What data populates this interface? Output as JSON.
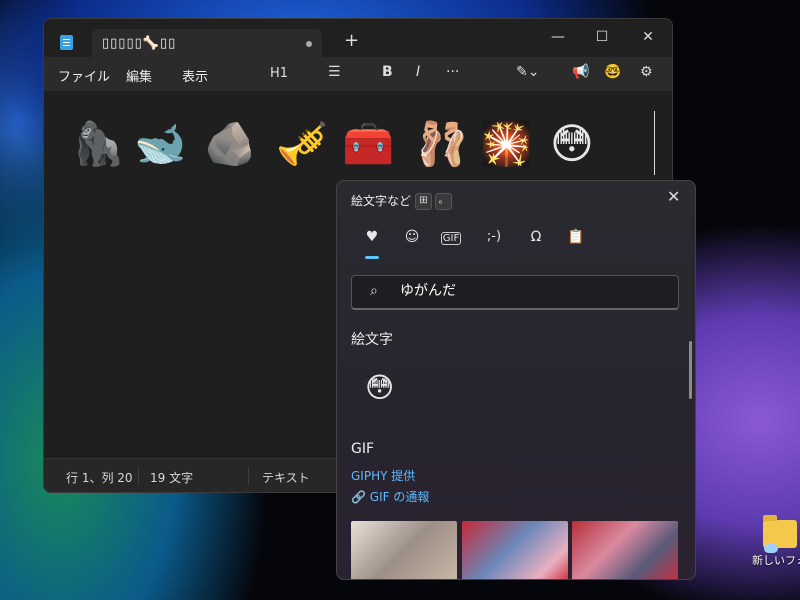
{
  "notepad": {
    "tab_title": "▯▯▯▯▯🦴▯▯",
    "menu": {
      "file": "ファイル",
      "edit": "編集",
      "view": "表示"
    },
    "toolbar": {
      "heading": "H1",
      "list": "☰",
      "bold": "B",
      "italic": "I",
      "more": "···"
    },
    "content_emojis": [
      "🦍",
      "🐋",
      "🪨",
      "🎺",
      "🧰",
      "🩰",
      "🎇",
      "😳"
    ],
    "status": {
      "position": "行 1、列 20",
      "count": "19 文字",
      "mode": "テキスト"
    }
  },
  "emoji_panel": {
    "title": "絵文字など",
    "shortcut_keys": [
      "⊞",
      "。"
    ],
    "tabs": [
      "♥",
      "☺",
      "GIF",
      ";-)",
      "Ω",
      "📋"
    ],
    "search": {
      "value": "ゆがんだ",
      "placeholder": ""
    },
    "sections": {
      "emoji": "絵文字",
      "gif": "GIF",
      "giphy": "GIPHY 提供",
      "report": "GIF の通報"
    },
    "result_emoji": "😳"
  },
  "desktop": {
    "folder_label": "新しいフォル"
  },
  "colors": {
    "accent": "#60c4ff",
    "link": "#5cb8ff",
    "window_bg": "#1f1f1f"
  }
}
